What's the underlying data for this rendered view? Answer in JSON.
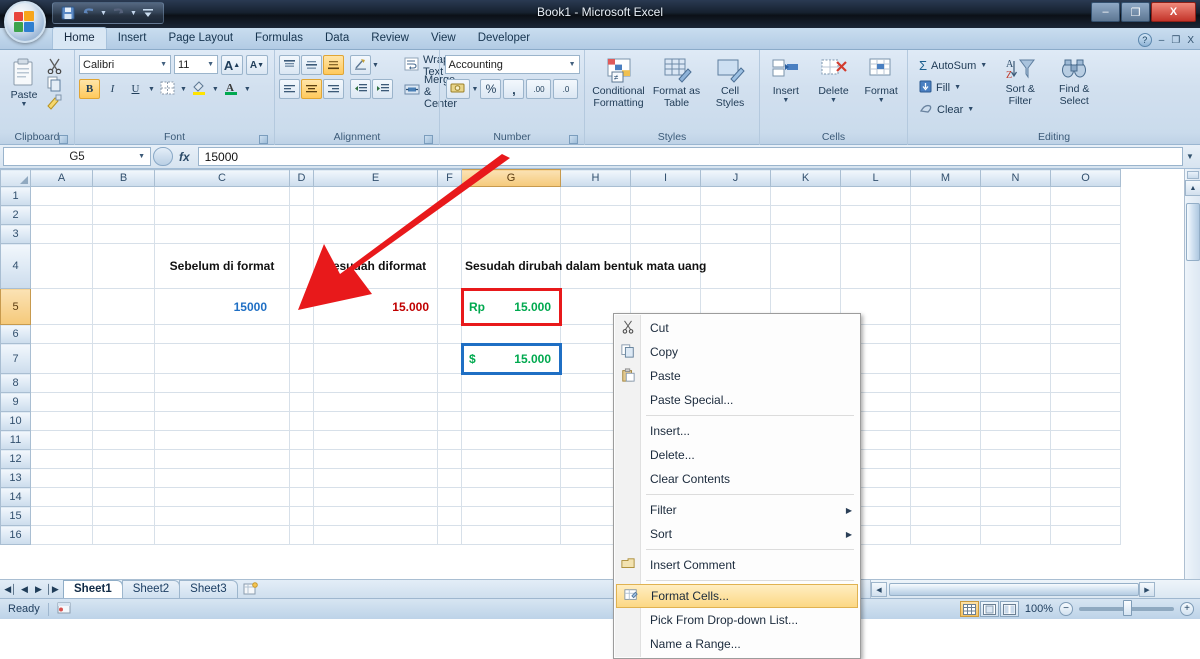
{
  "window": {
    "title": "Book1 - Microsoft Excel",
    "minimize": "–",
    "maximize": "❐",
    "close": "X"
  },
  "quick_access": {
    "save": "save-icon",
    "undo": "undo-icon",
    "redo": "redo-icon",
    "customize": "customize-icon"
  },
  "tabs": [
    {
      "label": "Home",
      "active": true
    },
    {
      "label": "Insert",
      "active": false
    },
    {
      "label": "Page Layout",
      "active": false
    },
    {
      "label": "Formulas",
      "active": false
    },
    {
      "label": "Data",
      "active": false
    },
    {
      "label": "Review",
      "active": false
    },
    {
      "label": "View",
      "active": false
    },
    {
      "label": "Developer",
      "active": false
    }
  ],
  "tabbar_right": {
    "help": "?",
    "minimize_ribbon": "–",
    "restore": "❐",
    "close": "X"
  },
  "ribbon": {
    "clipboard": {
      "label": "Clipboard",
      "paste": "Paste",
      "cut": "cut-icon",
      "copy": "copy-icon",
      "format_painter": "format-painter-icon"
    },
    "font": {
      "label": "Font",
      "font_name": "Calibri",
      "font_size": "11",
      "grow": "A",
      "shrink": "A",
      "bold": "B",
      "italic": "I",
      "underline": "U",
      "borders": "borders-icon",
      "fill_color": "fill-color-icon",
      "font_color": "font-color-icon"
    },
    "alignment": {
      "label": "Alignment",
      "wrap_text": "Wrap Text",
      "merge_center": "Merge & Center",
      "orientation": "orientation-icon",
      "decrease_indent": "decrease-indent-icon",
      "increase_indent": "increase-indent-icon"
    },
    "number": {
      "label": "Number",
      "format": "Accounting",
      "percent": "%",
      "comma": ",",
      "increase_decimal": ".00",
      "decrease_decimal": ".0"
    },
    "styles": {
      "label": "Styles",
      "items": [
        {
          "line1": "Conditional",
          "line2": "Formatting"
        },
        {
          "line1": "Format as",
          "line2": "Table"
        },
        {
          "line1": "Cell",
          "line2": "Styles"
        }
      ]
    },
    "cells": {
      "label": "Cells",
      "items": [
        {
          "line1": "Insert"
        },
        {
          "line1": "Delete"
        },
        {
          "line1": "Format"
        }
      ]
    },
    "editing": {
      "label": "Editing",
      "autosum": "AutoSum",
      "fill": "Fill",
      "clear": "Clear",
      "sort_filter_1": "Sort &",
      "sort_filter_2": "Filter",
      "find_select_1": "Find &",
      "find_select_2": "Select"
    }
  },
  "formula_bar": {
    "name_box": "G5",
    "fx": "fx",
    "value": "15000"
  },
  "grid": {
    "columns": [
      "A",
      "B",
      "C",
      "D",
      "E",
      "F",
      "G",
      "H",
      "I",
      "J",
      "K",
      "L",
      "M",
      "N",
      "O"
    ],
    "selected_column": "G",
    "rows": [
      "1",
      "2",
      "3",
      "4",
      "5",
      "6",
      "7",
      "8",
      "9",
      "10",
      "11",
      "12",
      "13",
      "14",
      "15",
      "16"
    ],
    "selected_row": "5",
    "cells": {
      "C4": "Sebelum di format",
      "E4": "Sesudah diformat",
      "G4": "Sesudah dirubah dalam bentuk mata uang",
      "C5": "15000",
      "E5": "15.000",
      "G5_symbol": "Rp",
      "G5_amount": "15.000",
      "G7_symbol": "$",
      "G7_amount": "15.000"
    },
    "colors": {
      "c5_text": "#1f6fc4",
      "e5_text": "#c00000",
      "currency_text": "#00a94f",
      "g5_border": "#e8191b",
      "g7_border": "#1f6fc4",
      "arrow": "#e8191b"
    }
  },
  "context_menu": {
    "items": [
      {
        "label": "Cut",
        "icon": "cut-icon",
        "accel": 2,
        "submenu": false,
        "highlighted": false,
        "separator_after": false
      },
      {
        "label": "Copy",
        "icon": "copy-icon",
        "accel": 0,
        "submenu": false,
        "highlighted": false,
        "separator_after": false
      },
      {
        "label": "Paste",
        "icon": "paste-icon",
        "accel": 0,
        "submenu": false,
        "highlighted": false,
        "separator_after": false
      },
      {
        "label": "Paste Special...",
        "icon": "",
        "accel": 6,
        "submenu": false,
        "highlighted": false,
        "separator_after": true
      },
      {
        "label": "Insert...",
        "icon": "",
        "accel": 0,
        "submenu": false,
        "highlighted": false,
        "separator_after": false
      },
      {
        "label": "Delete...",
        "icon": "",
        "accel": 0,
        "submenu": false,
        "highlighted": false,
        "separator_after": false
      },
      {
        "label": "Clear Contents",
        "icon": "",
        "accel": 8,
        "submenu": false,
        "highlighted": false,
        "separator_after": true
      },
      {
        "label": "Filter",
        "icon": "",
        "accel": 4,
        "submenu": true,
        "highlighted": false,
        "separator_after": false
      },
      {
        "label": "Sort",
        "icon": "",
        "accel": 1,
        "submenu": true,
        "highlighted": false,
        "separator_after": true
      },
      {
        "label": "Insert Comment",
        "icon": "comment-icon",
        "accel": 8,
        "submenu": false,
        "highlighted": false,
        "separator_after": true
      },
      {
        "label": "Format Cells...",
        "icon": "format-cells-icon",
        "accel": 0,
        "submenu": false,
        "highlighted": true,
        "separator_after": false
      },
      {
        "label": "Pick From Drop-down List...",
        "icon": "",
        "accel": 2,
        "submenu": false,
        "highlighted": false,
        "separator_after": false
      },
      {
        "label": "Name a Range...",
        "icon": "",
        "accel": 7,
        "submenu": false,
        "highlighted": false,
        "separator_after": false
      }
    ]
  },
  "sheet_tabs": {
    "nav": [
      "◀│",
      "◀",
      "▶",
      "│▶"
    ],
    "tabs": [
      {
        "label": "Sheet1",
        "active": true
      },
      {
        "label": "Sheet2",
        "active": false
      },
      {
        "label": "Sheet3",
        "active": false
      }
    ],
    "new_sheet": "insert-worksheet-icon"
  },
  "status_bar": {
    "state": "Ready",
    "macro_icon": "record-macro-icon",
    "views": [
      {
        "name": "normal-view",
        "glyph": "▦",
        "active": true
      },
      {
        "name": "page-layout-view",
        "glyph": "▤",
        "active": false
      },
      {
        "name": "page-break-view",
        "glyph": "▥",
        "active": false
      }
    ],
    "zoom": "100%",
    "zoom_out": "−",
    "zoom_in": "+"
  }
}
